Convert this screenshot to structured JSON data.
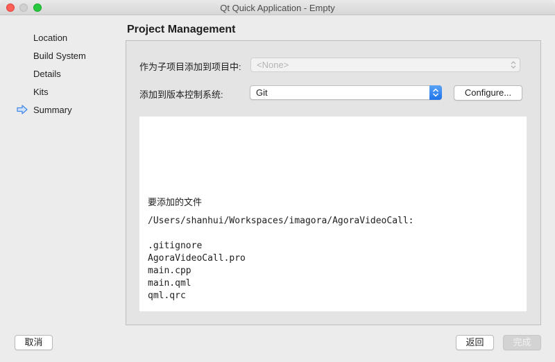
{
  "window": {
    "title": "Qt Quick Application - Empty"
  },
  "sidebar": {
    "steps": [
      {
        "label": "Location"
      },
      {
        "label": "Build System"
      },
      {
        "label": "Details"
      },
      {
        "label": "Kits"
      },
      {
        "label": "Summary",
        "current": true
      }
    ]
  },
  "page": {
    "title": "Project Management",
    "add_to_project_label": "作为子项目添加到项目中:",
    "add_to_project_value": "<None>",
    "vcs_label": "添加到版本控制系统:",
    "vcs_value": "Git",
    "configure_label": "Configure...",
    "files_heading": "要添加的文件",
    "files_path": "/Users/shanhui/Workspaces/imagora/AgoraVideoCall:",
    "files": [
      ".gitignore",
      "AgoraVideoCall.pro",
      "main.cpp",
      "main.qml",
      "qml.qrc"
    ]
  },
  "footer": {
    "cancel_label": "取消",
    "back_label": "返回",
    "finish_label": "完成"
  },
  "colors": {
    "accent": "#1e73e8",
    "close": "#fe5f57",
    "maximize": "#28c840"
  },
  "icons": {
    "current_step": "right-arrow-icon"
  }
}
